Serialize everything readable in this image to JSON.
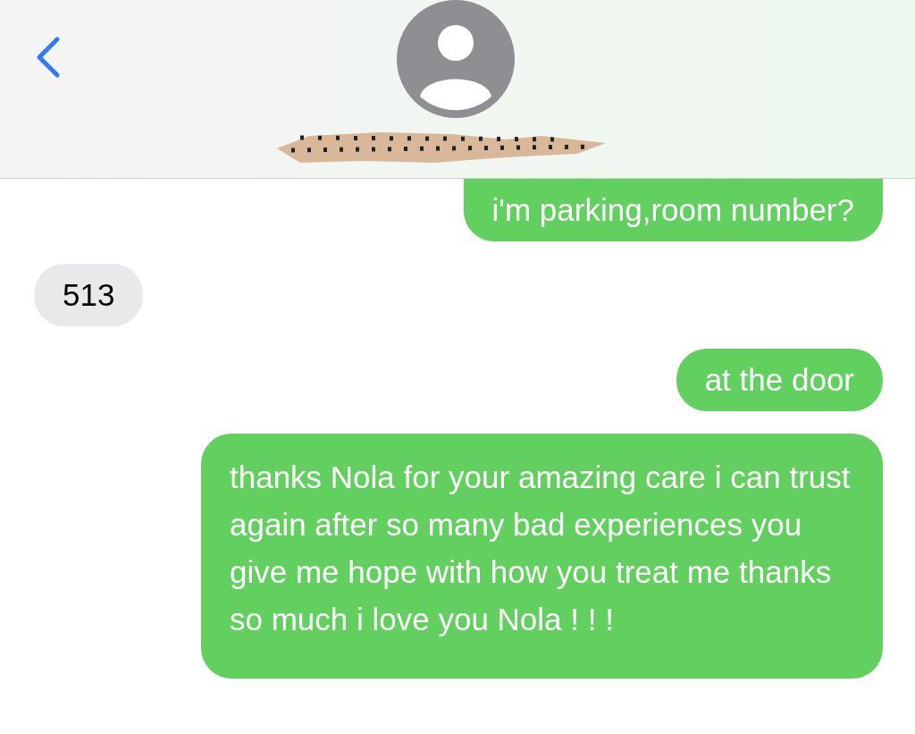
{
  "messages": [
    {
      "kind": "sent",
      "text": "i'm parking,room number?"
    },
    {
      "kind": "received",
      "text": "513"
    },
    {
      "kind": "sent",
      "text": "at the door"
    },
    {
      "kind": "sent",
      "text": "thanks Nola for your amazing care i can trust again after so many bad experiences you give me hope with how you treat me thanks so much i love you Nola ! ! !"
    }
  ]
}
